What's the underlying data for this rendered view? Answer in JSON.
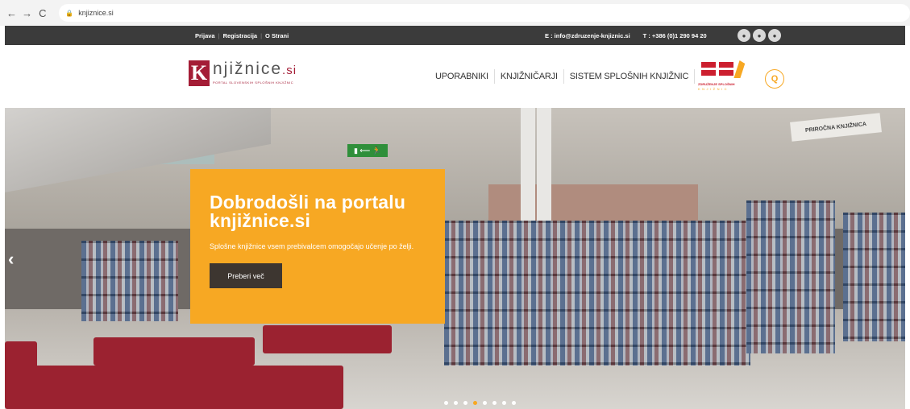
{
  "browser": {
    "url": "knjiznice.si",
    "back_icon": "←",
    "forward_icon": "→",
    "reload_icon": "C"
  },
  "topbar": {
    "links": [
      "Prijava",
      "Registracija",
      "O Strani"
    ],
    "email": "E : info@zdruzenje-knjiznic.si",
    "phone": "T : +386 (0)1 290 94 20",
    "social_icons": [
      "social-icon-1",
      "social-icon-2",
      "social-icon-3"
    ]
  },
  "header": {
    "logo_letter": "K",
    "logo_name": "njižnice",
    "logo_suffix": ".si",
    "logo_tagline": "PORTAL SLOVENSKIH SPLOŠNIH KNJIŽNIC",
    "nav": [
      "UPORABNIKI",
      "KNJIŽNIČARJI",
      "SISTEM SPLOŠNIH KNJIŽNIC"
    ],
    "partner_line1": "ZDRUŽENJE SPLOŠNIH",
    "partner_line2": "KNJIŽNIC",
    "search_icon": "Q"
  },
  "hero": {
    "title": "Dobrodošli na portalu knjižnice.si",
    "text": "Splošne knjižnice vsem prebivalcem omogočajo učenje po želji.",
    "button": "Preberi več",
    "exit_sign": "▮ ⟵ 🏃",
    "sign_text": "PRIROČNA KNJIŽNICA",
    "prev_arrow": "‹",
    "slides_count": 8,
    "active_slide": 4
  },
  "colors": {
    "accent": "#f7a823",
    "brand": "#a41d36",
    "topbar": "#3b3b3b"
  }
}
